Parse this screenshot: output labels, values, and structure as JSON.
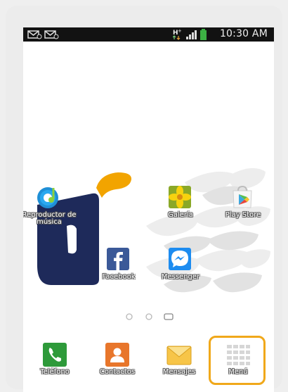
{
  "status_bar": {
    "time": "10:30 AM",
    "icons": [
      "mail-icon",
      "mail-icon",
      "h-plus-data-icon",
      "signal-icon",
      "battery-icon"
    ]
  },
  "home": {
    "apps": [
      {
        "name": "music-player",
        "label": "Reproductor de música",
        "icon": "music-note-icon"
      },
      {
        "name": "gallery",
        "label": "Galería",
        "icon": "gallery-flower-icon"
      },
      {
        "name": "play-store",
        "label": "Play Store",
        "icon": "play-store-bag-icon"
      },
      {
        "name": "facebook",
        "label": "Facebook",
        "icon": "facebook-icon"
      },
      {
        "name": "messenger",
        "label": "Messenger",
        "icon": "messenger-icon"
      }
    ],
    "page_indicators": 3,
    "active_page": 3
  },
  "dock": {
    "items": [
      {
        "name": "phone",
        "label": "Teléfono",
        "icon": "phone-icon"
      },
      {
        "name": "contacts",
        "label": "Contactos",
        "icon": "contacts-icon"
      },
      {
        "name": "messages",
        "label": "Mensajes",
        "icon": "envelope-icon"
      },
      {
        "name": "menu",
        "label": "Menú",
        "icon": "app-grid-icon"
      }
    ],
    "highlight_color": "#f0a81a"
  },
  "colors": {
    "status_bar": "#121212",
    "battery": "#3cb043",
    "logo_navy": "#1e2a5a",
    "logo_orange": "#f2a400"
  }
}
